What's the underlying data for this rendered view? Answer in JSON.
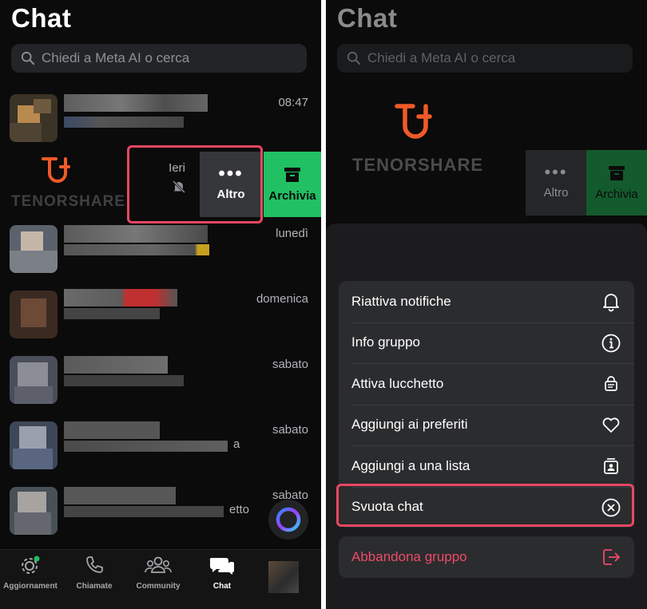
{
  "left_panel": {
    "title": "Chat",
    "search_placeholder": "Chiedi a Meta AI o cerca",
    "rows": [
      {
        "time": "08:47"
      },
      {
        "time": "Ieri"
      },
      {
        "time": "lunedì"
      },
      {
        "time": "domenica"
      },
      {
        "time": "sabato"
      },
      {
        "time": "sabato",
        "preview_suffix": "a"
      },
      {
        "time": "sabato",
        "preview_suffix": "etto"
      }
    ],
    "swipe": {
      "more_label": "Altro",
      "archive_label": "Archivia"
    },
    "watermark": "TENORSHARE",
    "tabs": [
      {
        "label": "Aggiornament",
        "icon": "updates-icon"
      },
      {
        "label": "Chiamate",
        "icon": "phone-icon"
      },
      {
        "label": "Community",
        "icon": "community-icon"
      },
      {
        "label": "Chat",
        "icon": "chat-icon"
      }
    ]
  },
  "right_panel": {
    "title": "Chat",
    "search_placeholder": "Chiedi a Meta AI o cerca",
    "watermark": "TENORSHARE",
    "swipe": {
      "more_label": "Altro",
      "archive_label": "Archivia"
    },
    "menu": [
      {
        "label": "Riattiva notifiche",
        "icon": "bell-icon"
      },
      {
        "label": "Info gruppo",
        "icon": "info-icon"
      },
      {
        "label": "Attiva lucchetto",
        "icon": "lock-chat-icon"
      },
      {
        "label": "Aggiungi ai preferiti",
        "icon": "heart-icon"
      },
      {
        "label": "Aggiungi a una lista",
        "icon": "list-icon"
      },
      {
        "label": "Svuota chat",
        "icon": "clear-icon"
      }
    ],
    "leave_label": "Abbandona gruppo",
    "leave_icon": "exit-icon"
  },
  "colors": {
    "accent_red": "#e94763",
    "archive_green": "#21c063",
    "brand_orange": "#f05a28",
    "danger_text": "#ef4a6a"
  }
}
